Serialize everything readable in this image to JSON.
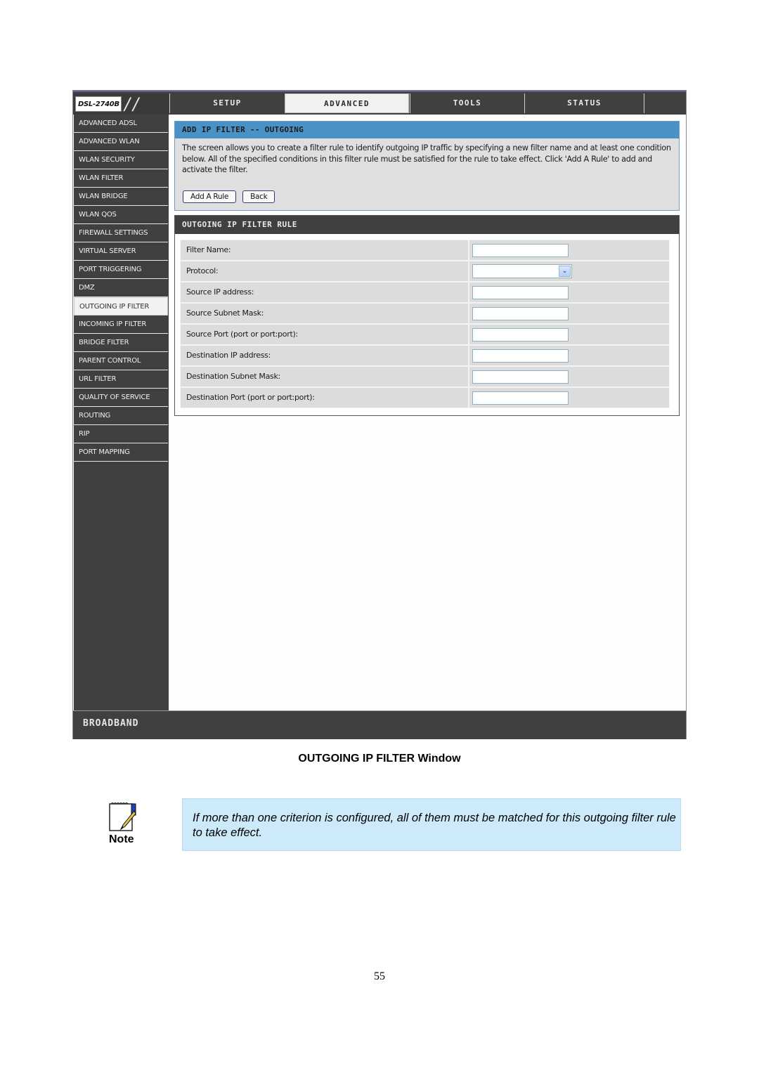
{
  "router_ui": {
    "model_logo": "DSL-2740B",
    "tabs": [
      {
        "label": "SETUP",
        "active": false
      },
      {
        "label": "ADVANCED",
        "active": true
      },
      {
        "label": "TOOLS",
        "active": false
      },
      {
        "label": "STATUS",
        "active": false
      }
    ],
    "sidebar": {
      "items": [
        {
          "label": "ADVANCED ADSL",
          "active": false
        },
        {
          "label": "ADVANCED WLAN",
          "active": false
        },
        {
          "label": "WLAN SECURITY",
          "active": false
        },
        {
          "label": "WLAN FILTER",
          "active": false
        },
        {
          "label": "WLAN BRIDGE",
          "active": false
        },
        {
          "label": "WLAN QOS",
          "active": false
        },
        {
          "label": "FIREWALL SETTINGS",
          "active": false
        },
        {
          "label": "VIRTUAL SERVER",
          "active": false
        },
        {
          "label": "PORT TRIGGERING",
          "active": false
        },
        {
          "label": "DMZ",
          "active": false
        },
        {
          "label": "OUTGOING IP FILTER",
          "active": true
        },
        {
          "label": "INCOMING IP FILTER",
          "active": false
        },
        {
          "label": "BRIDGE FILTER",
          "active": false
        },
        {
          "label": "PARENT CONTROL",
          "active": false
        },
        {
          "label": "URL FILTER",
          "active": false
        },
        {
          "label": "QUALITY OF SERVICE",
          "active": false
        },
        {
          "label": "ROUTING",
          "active": false
        },
        {
          "label": "RIP",
          "active": false
        },
        {
          "label": "PORT MAPPING",
          "active": false
        }
      ]
    },
    "info_section": {
      "title": "ADD IP FILTER -- OUTGOING",
      "description": "The screen allows you to create a filter rule to identify outgoing IP traffic by specifying a new filter name and at least one condition below. All of the specified conditions in this filter rule must be satisfied for the rule to take effect. Click 'Add A Rule' to add and activate the filter.",
      "buttons": {
        "add_rule": "Add A Rule",
        "back": "Back"
      }
    },
    "rule_section": {
      "title": "OUTGOING IP FILTER RULE",
      "fields": [
        {
          "label": "Filter Name:",
          "type": "text",
          "value": ""
        },
        {
          "label": "Protocol:",
          "type": "select",
          "value": ""
        },
        {
          "label": "Source IP address:",
          "type": "text",
          "value": ""
        },
        {
          "label": "Source Subnet Mask:",
          "type": "text",
          "value": ""
        },
        {
          "label": "Source Port (port or port:port):",
          "type": "text",
          "value": ""
        },
        {
          "label": "Destination IP address:",
          "type": "text",
          "value": ""
        },
        {
          "label": "Destination Subnet Mask:",
          "type": "text",
          "value": ""
        },
        {
          "label": "Destination Port (port or port:port):",
          "type": "text",
          "value": ""
        }
      ]
    },
    "footer_brand": "BROADBAND"
  },
  "document": {
    "caption": "OUTGOING IP FILTER Window",
    "note_label": "Note",
    "note_text": "If more than one criterion is configured, all of them must be matched for this outgoing filter rule to take effect.",
    "page_number": "55"
  },
  "colors": {
    "dark_bar": "#404040",
    "info_header_blue": "#4a92c5",
    "panel_gray": "#dfdfdf",
    "note_background": "#cdeafb"
  }
}
